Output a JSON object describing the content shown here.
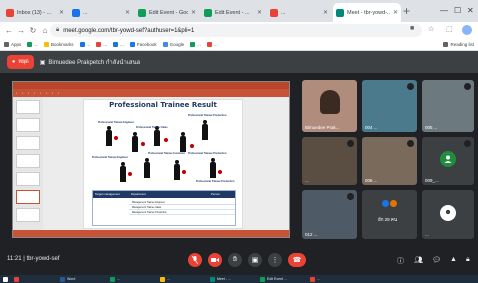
{
  "browser": {
    "tabs": [
      {
        "title": "Inbox (13) - ...",
        "color": "#ea4335"
      },
      {
        "title": "...",
        "color": "#1a73e8"
      },
      {
        "title": "Edit Event - Google ...",
        "color": "#0f9d58"
      },
      {
        "title": "Edit Event - ...",
        "color": "#0f9d58"
      },
      {
        "title": "...",
        "color": "#ea4335"
      },
      {
        "title": "Meet - tbr-yowd-...",
        "color": "#00897b",
        "active": true
      }
    ],
    "url": "meet.google.com/tbr-yowd-sef?authuser=1&pli=1",
    "bookmarks": [
      {
        "label": "Apps",
        "color": "#5f6368"
      },
      {
        "label": "...",
        "color": "#0f9d58"
      },
      {
        "label": "Bookmarks",
        "color": "#fbbc04"
      },
      {
        "label": "...",
        "color": "#1a73e8"
      },
      {
        "label": "...",
        "color": "#ea4335"
      },
      {
        "label": "...",
        "color": "#1a73e8"
      },
      {
        "label": "Facebook",
        "color": "#1877f2"
      },
      {
        "label": "Google",
        "color": "#4285f4"
      },
      {
        "label": "...",
        "color": "#0f9d58"
      },
      {
        "label": "...",
        "color": "#ea4335"
      },
      {
        "label": "Reading list",
        "color": "#5f6368"
      }
    ]
  },
  "meet": {
    "stop_label": "หยุด",
    "presenter": "Bimuedee Prakpetch กำลังนำเสนอ",
    "slide": {
      "title": "Professional Trainee Result",
      "labels": [
        "Professional Trainee Engineer",
        "Professional Trainee Sales",
        "Professional Trainee Production",
        "Professional Trainee Customer",
        "Professional Trainee Production",
        "Professional Trainee Engineer",
        "Professional Trainee Production"
      ],
      "table": {
        "headers": [
          "Target management",
          "Department",
          "Person"
        ],
        "rows": [
          "Management Trainee Engineer",
          "Management Trainee Sales",
          "Management Trainee Production"
        ]
      }
    },
    "participants": [
      {
        "name": "Bimuedee Prak...",
        "bg": "#b08c7c"
      },
      {
        "name": "004 ...",
        "bg": "#4a7a8c"
      },
      {
        "name": "005 ...",
        "bg": "#6c7a80"
      },
      {
        "name": "...",
        "bg": "#5a4d42"
      },
      {
        "name": "006 ...",
        "bg": "#7a6a5c"
      },
      {
        "name": "009_...",
        "bg": "#3c4043",
        "avatar": "#1e8e3e"
      },
      {
        "name": "012 ...",
        "bg": "#4e5a66"
      },
      {
        "name": "อีก 29 คน",
        "bg": "#3c4043"
      },
      {
        "name": "...",
        "bg": "#3c4043"
      }
    ],
    "meeting_info": "11:21 | tbr-yowd-sef"
  },
  "taskbar": [
    {
      "label": "",
      "color": "#ea4335"
    },
    {
      "label": "Word",
      "color": "#2b579a"
    },
    {
      "label": "...",
      "color": "#0f9d58"
    },
    {
      "label": "...",
      "color": "#fbbc04"
    },
    {
      "label": "Meet - ...",
      "color": "#00897b"
    },
    {
      "label": "Edit Event ...",
      "color": "#0f9d58"
    },
    {
      "label": "...",
      "color": "#ea4335"
    }
  ]
}
